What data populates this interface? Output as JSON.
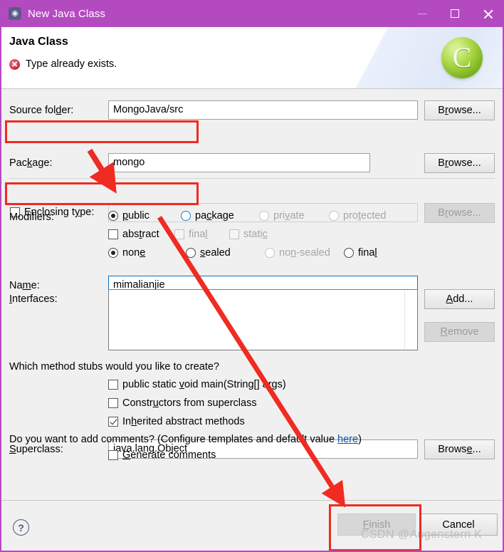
{
  "window": {
    "title": "New Java Class",
    "icon": "cog-icon",
    "controls": {
      "minimize": "–",
      "maximize": "□",
      "close": "✕"
    }
  },
  "header": {
    "title": "Java Class",
    "message": "Type already exists.",
    "message_icon": "error-icon",
    "badge_letter": "C",
    "badge_color": "#8fc63d"
  },
  "form": {
    "source_folder": {
      "label": "Source folder:",
      "value": "MongoJava/src",
      "browse": "Browse..."
    },
    "package": {
      "label": "Package:",
      "value": "mongo",
      "browse": "Browse..."
    },
    "enclosing_type": {
      "label": "Enclosing type:",
      "value": "",
      "browse": "Browse...",
      "checked": false
    },
    "name": {
      "label": "Name:",
      "value": "mimalianjie"
    },
    "modifiers": {
      "label": "Modifiers:",
      "access": [
        {
          "label": "public",
          "selected": true,
          "disabled": false
        },
        {
          "label": "package",
          "selected": false,
          "disabled": false
        },
        {
          "label": "private",
          "selected": false,
          "disabled": true
        },
        {
          "label": "protected",
          "selected": false,
          "disabled": true
        }
      ],
      "flags": [
        {
          "label": "abstract",
          "checked": false,
          "disabled": false
        },
        {
          "label": "final",
          "checked": false,
          "disabled": true
        },
        {
          "label": "static",
          "checked": false,
          "disabled": true
        }
      ],
      "sealed": [
        {
          "label": "none",
          "selected": true,
          "disabled": false
        },
        {
          "label": "sealed",
          "selected": false,
          "disabled": false
        },
        {
          "label": "non-sealed",
          "selected": false,
          "disabled": true
        },
        {
          "label": "final",
          "selected": false,
          "disabled": false
        }
      ]
    },
    "superclass": {
      "label": "Superclass:",
      "value": "java.lang.Object",
      "browse": "Browse..."
    },
    "interfaces": {
      "label": "Interfaces:",
      "items": [],
      "add": "Add...",
      "remove": "Remove"
    },
    "stubs": {
      "question": "Which method stubs would you like to create?",
      "options": [
        {
          "label": "public static void main(String[] args)",
          "checked": false
        },
        {
          "label": "Constructors from superclass",
          "checked": false
        },
        {
          "label": "Inherited abstract methods",
          "checked": true
        }
      ]
    },
    "comments": {
      "question_prefix": "Do you want to add comments? (Configure templates and default value ",
      "link": "here",
      "question_suffix": ")",
      "option": {
        "label": "Generate comments",
        "checked": false
      }
    }
  },
  "footer": {
    "help": "?",
    "finish": "Finish",
    "finish_disabled": true,
    "cancel": "Cancel"
  },
  "watermark": "CSDN @Augenstern K",
  "annotations": {
    "highlight_color": "#f02b22",
    "boxes": [
      "package-row",
      "name-row",
      "finish-button"
    ],
    "arrows": [
      "enclosing-type-to-name",
      "modifiers-to-finish"
    ]
  }
}
